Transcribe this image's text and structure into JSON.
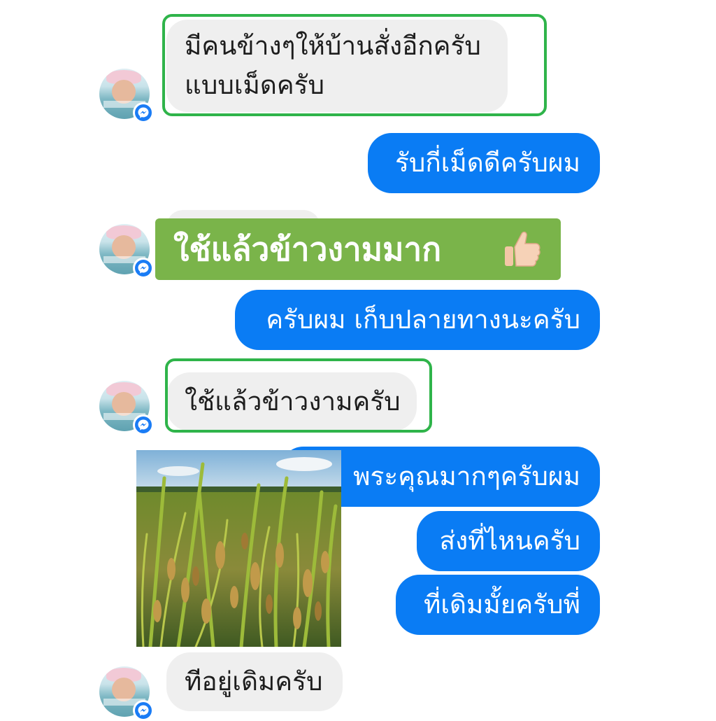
{
  "chat": {
    "messages": [
      {
        "sender": "them",
        "lines": [
          "มีคนข้างๆให้บ้านสั่งอีกครับ",
          "แบบเม็ดครับ"
        ]
      },
      {
        "sender": "me",
        "text": "รับกี่เม็ดดีครับผม"
      },
      {
        "sender": "them",
        "text": "ใช้แล้วข้าวงามมาก",
        "emoji": "👍🏻"
      },
      {
        "sender": "me",
        "text": "ครับผม เก็บปลายทางนะครับ"
      },
      {
        "sender": "them",
        "text": "ใช้แล้วข้าวงามครับ"
      },
      {
        "sender": "me",
        "text": "พระคุณมากๆครับผม"
      },
      {
        "sender": "me",
        "text": "ส่งที่ไหนครับ"
      },
      {
        "sender": "me",
        "text": "ที่เดิมมั้ยครับพี่"
      },
      {
        "sender": "them",
        "text": "ทีอยู่เดิมครับ"
      }
    ]
  },
  "colors": {
    "outgoing_bubble": "#0a7cf4",
    "incoming_bubble": "#efefef",
    "highlight_outline": "#2fb44a",
    "highlight_banner": "#7ab44a",
    "messenger_badge": "#1a7cf5"
  },
  "icons": {
    "badge": "messenger-icon",
    "reaction": "thumbs-up-icon"
  }
}
